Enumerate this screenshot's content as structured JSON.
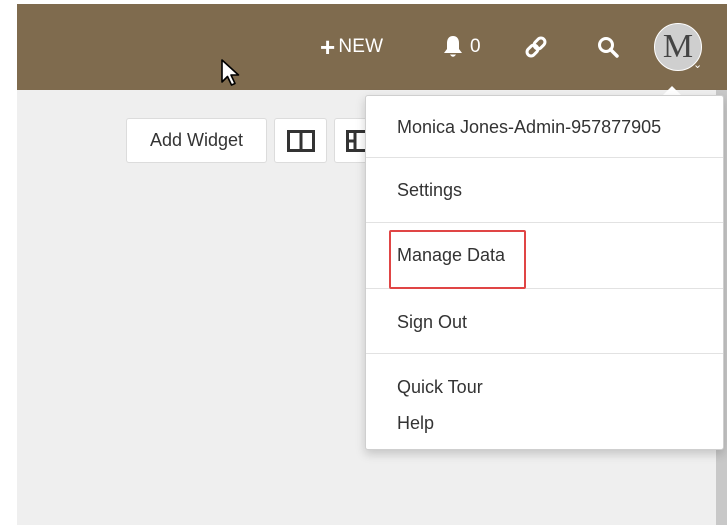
{
  "header": {
    "new_label": "NEW",
    "notification_count": "0",
    "avatar_initial": "M"
  },
  "toolbar": {
    "add_widget_label": "Add Widget"
  },
  "user_menu": {
    "username": "Monica Jones-Admin-957877905",
    "items": {
      "settings": "Settings",
      "manage_data": "Manage Data",
      "sign_out": "Sign Out",
      "quick_tour": "Quick Tour",
      "help": "Help"
    }
  },
  "colors": {
    "header_bg": "#7f6b4e",
    "content_bg": "#efefef",
    "highlight": "#e04545"
  }
}
